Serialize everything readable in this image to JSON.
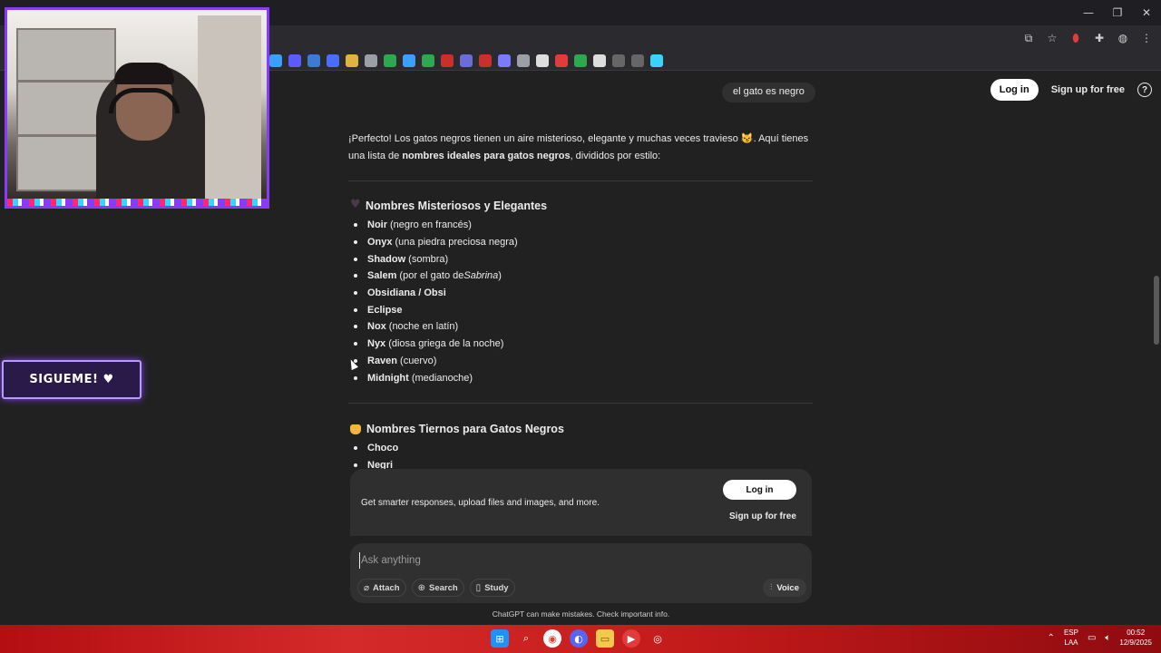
{
  "window": {
    "controls": {
      "minimize": "—",
      "restore": "❐",
      "close": "✕"
    }
  },
  "toolbar": {
    "icons": [
      "translate-icon",
      "star-icon",
      "extension-red-icon",
      "puzzle-icon",
      "profile-icon",
      "menu-icon"
    ]
  },
  "bookmarks": {
    "colors": [
      "#3aa0ff",
      "#5b5bff",
      "#3a7bd5",
      "#4a6cff",
      "#e0b341",
      "#9aa0a6",
      "#2ea84f",
      "#3aa0ff",
      "#2ea84f",
      "#c9302c",
      "#6b6bd9",
      "#c9302c",
      "#7a7aff",
      "#9aa0a6",
      "#dddddd",
      "#e23b3b",
      "#2ea84f",
      "#dddddd",
      "#666666",
      "#666666",
      "#3ad3ff"
    ]
  },
  "header": {
    "login_label": "Log in",
    "signup_label": "Sign up for free",
    "help_label": "?"
  },
  "chat": {
    "user_message": "el gato es negro",
    "intro_part1": "¡Perfecto! Los gatos negros tienen un aire misterioso, elegante y muchas veces travieso 😼. Aquí tienes una lista de ",
    "intro_bold": "nombres ideales para gatos negros",
    "intro_part2": ", divididos por estilo:",
    "section1": {
      "title": "Nombres Misteriosos y Elegantes",
      "items": [
        {
          "name": "Noir",
          "desc": "(negro en francés)"
        },
        {
          "name": "Onyx",
          "desc": "(una piedra preciosa negra)"
        },
        {
          "name": "Shadow",
          "desc": "(sombra)"
        },
        {
          "name": "Salem",
          "desc_pre": "(por el gato de ",
          "desc_italic": "Sabrina",
          "desc_post": ")"
        },
        {
          "name": "Obsidiana / Obsi",
          "desc": ""
        },
        {
          "name": "Eclipse",
          "desc": ""
        },
        {
          "name": "Nox",
          "desc": "(noche en latín)"
        },
        {
          "name": "Nyx",
          "desc": "(diosa griega de la noche)"
        },
        {
          "name": "Raven",
          "desc": "(cuervo)"
        },
        {
          "name": "Midnight",
          "desc": "(medianoche)"
        }
      ]
    },
    "section2": {
      "title": "Nombres Tiernos para Gatos Negros",
      "items": [
        {
          "name": "Choco",
          "desc": ""
        },
        {
          "name": "Negri",
          "desc": ""
        }
      ]
    }
  },
  "promo": {
    "text": "Get smarter responses, upload files and images, and more.",
    "login_label": "Log in",
    "signup_label": "Sign up for free"
  },
  "composer": {
    "placeholder": "Ask anything",
    "attach_label": "Attach",
    "search_label": "Search",
    "study_label": "Study",
    "voice_label": "Voice"
  },
  "disclaimer": "ChatGPT can make mistakes. Check important info.",
  "overlay": {
    "follow_label": "SIGUEME! ♥"
  },
  "taskbar": {
    "lang_top": "ESP",
    "lang_bottom": "LAA",
    "time": "00:52",
    "date": "12/9/2025"
  }
}
